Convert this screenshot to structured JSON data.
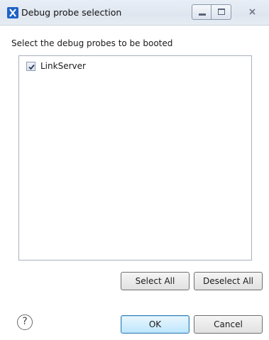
{
  "window": {
    "title": "Debug probe selection",
    "controls": {
      "minimize": "minimize",
      "maximize": "maximize",
      "close": "close"
    }
  },
  "main": {
    "instruction": "Select the debug probes to be booted",
    "probes": [
      {
        "label": "LinkServer",
        "checked": true
      }
    ],
    "select_all_label": "Select All",
    "deselect_all_label": "Deselect All"
  },
  "footer": {
    "help_glyph": "?",
    "ok_label": "OK",
    "cancel_label": "Cancel"
  },
  "colors": {
    "titlebar": "#dfe6ef",
    "accent": "#1e62c8"
  }
}
